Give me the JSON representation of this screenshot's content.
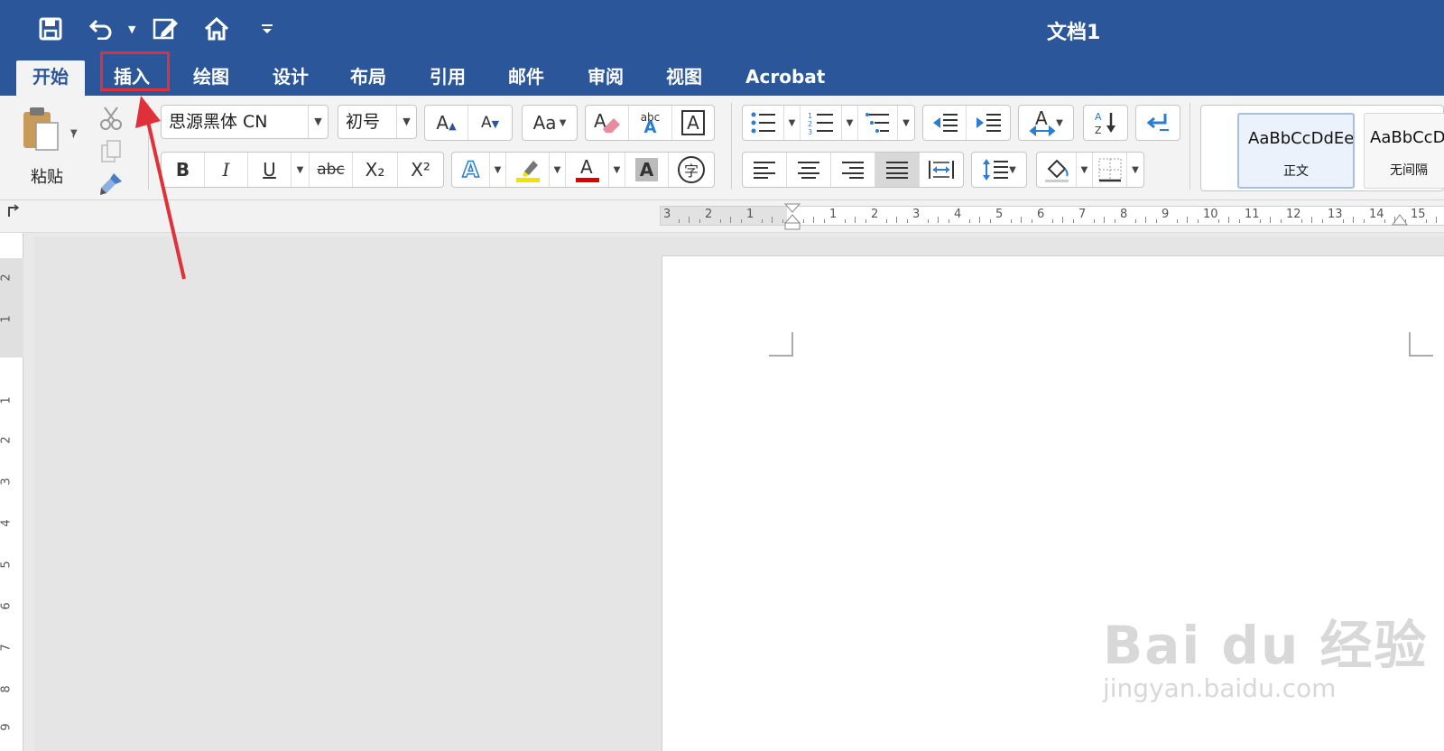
{
  "window": {
    "title": "文档1"
  },
  "tabs": [
    {
      "label": "开始",
      "active": true
    },
    {
      "label": "插入",
      "active": false
    },
    {
      "label": "绘图",
      "active": false
    },
    {
      "label": "设计",
      "active": false
    },
    {
      "label": "布局",
      "active": false
    },
    {
      "label": "引用",
      "active": false
    },
    {
      "label": "邮件",
      "active": false
    },
    {
      "label": "审阅",
      "active": false
    },
    {
      "label": "视图",
      "active": false
    },
    {
      "label": "Acrobat",
      "active": false
    }
  ],
  "ribbon": {
    "paste_label": "粘贴",
    "font_name": "思源黑体 CN",
    "font_size": "初号",
    "format_buttons": {
      "bold": "B",
      "italic": "I",
      "underline": "U",
      "strike": "abc",
      "subscript": "X₂",
      "superscript": "X²"
    },
    "spelling_label": "abc"
  },
  "styles": [
    {
      "sample": "AaBbCcDdEe",
      "name": "正文",
      "selected": true
    },
    {
      "sample": "AaBbCcDc",
      "name": "无间隔",
      "selected": false
    }
  ],
  "ruler": {
    "h_numbers": [
      "3",
      "2",
      "1",
      "1",
      "2",
      "3",
      "4",
      "5",
      "6",
      "7",
      "8",
      "9",
      "10",
      "11",
      "12",
      "13",
      "14",
      "15"
    ],
    "v_numbers": [
      "2",
      "1",
      "1",
      "2",
      "3",
      "4",
      "5",
      "6",
      "7",
      "8",
      "9"
    ]
  },
  "watermark": {
    "line1": "Bai du 经验",
    "line2": "jingyan.baidu.com"
  },
  "colors": {
    "accent": "#2b579a",
    "highlight_box": "#e0313a",
    "arrow": "#e0313a",
    "font_color_bar": "#e00000",
    "highlight_color_bar": "#f5e100"
  }
}
